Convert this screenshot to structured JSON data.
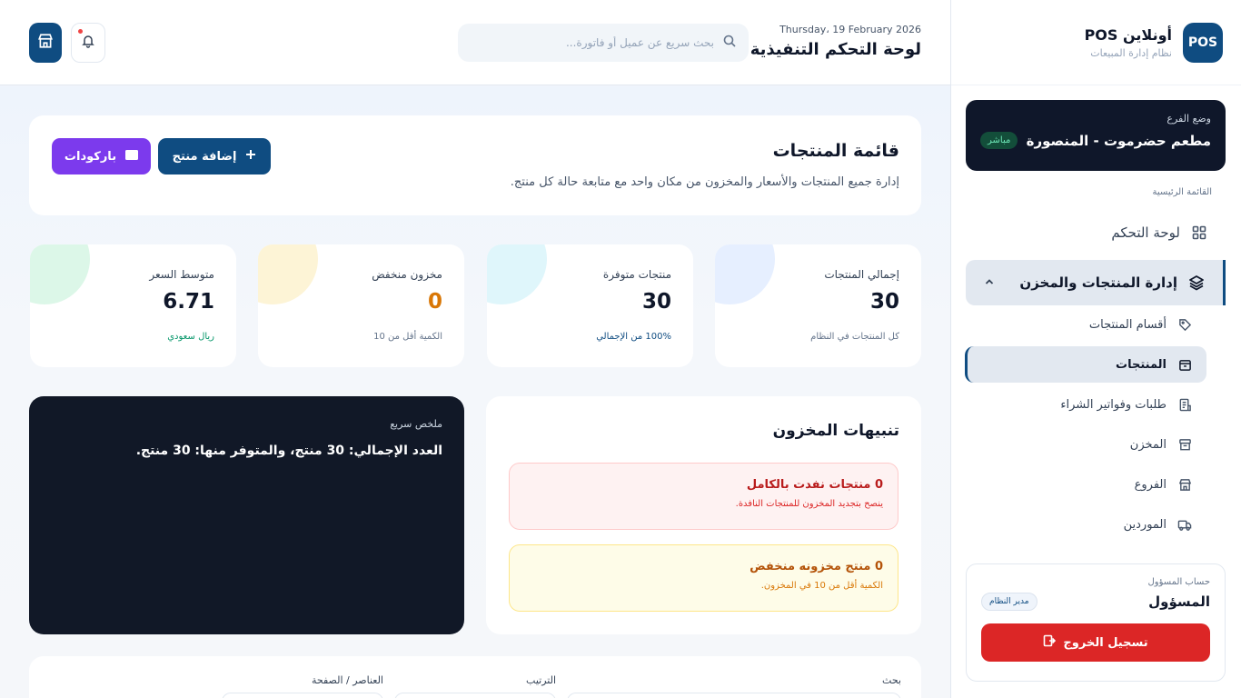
{
  "brand": {
    "logo": "POS",
    "name": "أونلاين POS",
    "subtitle": "نظام إدارة المبيعات"
  },
  "branch": {
    "label": "وضع الفرع",
    "name": "مطعم حضرموت - المنصورة",
    "badge": "مباشر"
  },
  "sidebar": {
    "section_label": "القائمة الرئيسية",
    "dashboard": {
      "label": "لوحة التحكم",
      "icon": "grid-icon"
    },
    "group": {
      "label": "إدارة المنتجات والمخزن",
      "icon": "layers-icon",
      "expanded": true
    },
    "sub_items": [
      {
        "label": "أقسام المنتجات",
        "icon": "tag-icon"
      },
      {
        "label": "المنتجات",
        "icon": "box-icon",
        "active": true
      },
      {
        "label": "طلبات وفواتير الشراء",
        "icon": "receipt-icon"
      },
      {
        "label": "المخزن",
        "icon": "archive-icon"
      },
      {
        "label": "الفروع",
        "icon": "store-icon"
      },
      {
        "label": "الموردين",
        "icon": "truck-icon"
      }
    ]
  },
  "account": {
    "label": "حساب المسؤول",
    "name": "المسؤول",
    "role": "مدير النظام",
    "logout_label": "تسجيل الخروج"
  },
  "topbar": {
    "date": "Thursday، 19 February 2026",
    "title": "لوحة التحكم التنفيذية",
    "search_placeholder": "بحث سريع عن عميل أو فاتورة..."
  },
  "header": {
    "title": "قائمة المنتجات",
    "description": "إدارة جميع المنتجات والأسعار والمخزون من مكان واحد مع متابعة حالة كل منتج.",
    "add_label": "إضافة منتج",
    "barcode_label": "باركودات"
  },
  "stats": [
    {
      "label": "إجمالي المنتجات",
      "value": "30",
      "note": "كل المنتجات في النظام",
      "blob_color": "#e6efff",
      "value_color": "#0f172a",
      "note_color": "#64748b"
    },
    {
      "label": "منتجات متوفرة",
      "value": "30",
      "note": "100% من الإجمالي",
      "blob_color": "#dff6fb",
      "value_color": "#0f172a",
      "note_color": "#0f4c81"
    },
    {
      "label": "مخزون منخفض",
      "value": "0",
      "note": "الكمية أقل من 10",
      "blob_color": "#fdf4d6",
      "value_color": "#d97706",
      "note_color": "#64748b"
    },
    {
      "label": "متوسط السعر",
      "value": "6.71",
      "note": "ريال سعودي",
      "blob_color": "#dcf7e8",
      "value_color": "#0f172a",
      "note_color": "#059669"
    }
  ],
  "alerts": {
    "title": "تنبيهات المخزون",
    "out_of_stock": {
      "title": "0 منتجات نفدت بالكامل",
      "subtitle": "ينصح بتجديد المخزون للمنتجات النافدة."
    },
    "low_stock": {
      "title": "0 منتج مخزونه منخفض",
      "subtitle": "الكمية أقل من 10 في المخزون."
    }
  },
  "summary": {
    "label": "ملخص سريع",
    "text": "العدد الإجمالي: 30 منتج، والمتوفر منها: 30 منتج."
  },
  "filters": {
    "search_label": "بحث",
    "sort_label": "الترتيب",
    "per_page_label": "العناصر / الصفحة"
  }
}
